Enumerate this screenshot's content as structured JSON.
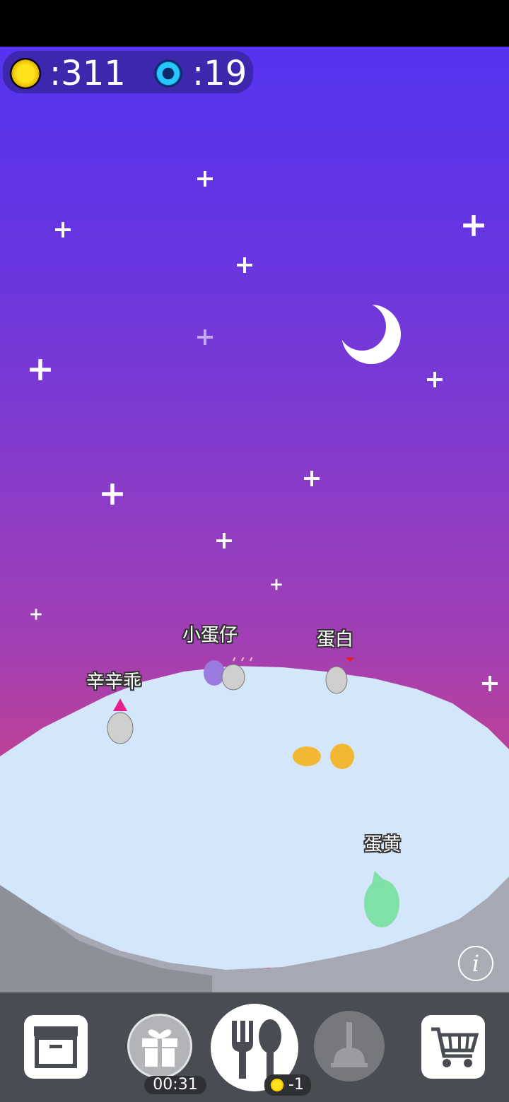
{
  "hud": {
    "coins": ":311",
    "gems": ":19",
    "coin_icon": "coin-icon",
    "gem_icon": "gem-icon"
  },
  "pets": [
    {
      "name": "小蛋仔",
      "color": "#9b7be0"
    },
    {
      "name": "蛋白",
      "color": "#cfcfcf"
    },
    {
      "name": "辛辛乖",
      "color": "#cfcfcf"
    },
    {
      "name": "蛋黄",
      "color": "#7fe0a8"
    }
  ],
  "toolbar": {
    "gift_timer": "00:31",
    "feed_cost": "-1",
    "items": [
      "storage-box-icon",
      "gift-icon",
      "fork-spoon-icon",
      "plunger-icon",
      "shopping-cart-icon"
    ]
  },
  "info_label": "i",
  "colors": {
    "sky_top": "#5533ef",
    "sky_bottom": "#e24a6c",
    "ground": "#d4e7fa",
    "toolbar": "#4a4c53"
  }
}
